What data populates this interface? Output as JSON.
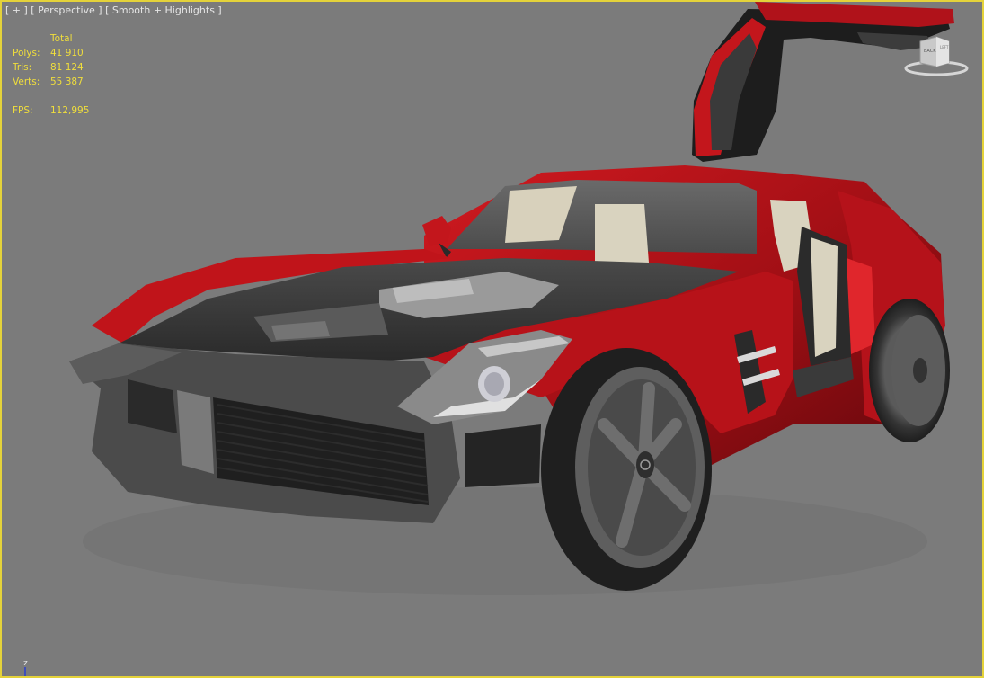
{
  "viewport": {
    "label_plus": "[ + ]",
    "label_view": "[ Perspective ]",
    "label_shading": "[ Smooth + Highlights ]",
    "border_color": "#e4d23a",
    "background": "#7b7b7b"
  },
  "stats": {
    "header": "Total",
    "polys_label": "Polys:",
    "polys_value": "41 910",
    "tris_label": "Tris:",
    "tris_value": "81 124",
    "verts_label": "Verts:",
    "verts_value": "55 387",
    "fps_label": "FPS:",
    "fps_value": "112,995",
    "color": "#f0de3c"
  },
  "viewcube": {
    "face_label": "BACK",
    "side_label": "LEFT"
  },
  "axis": {
    "z_label": "z"
  },
  "colors": {
    "body_red": "#c0141a",
    "body_red_dark": "#6e0a0e",
    "trim_dark": "#3d3d3d",
    "interior_beige": "#d9d3bf"
  }
}
